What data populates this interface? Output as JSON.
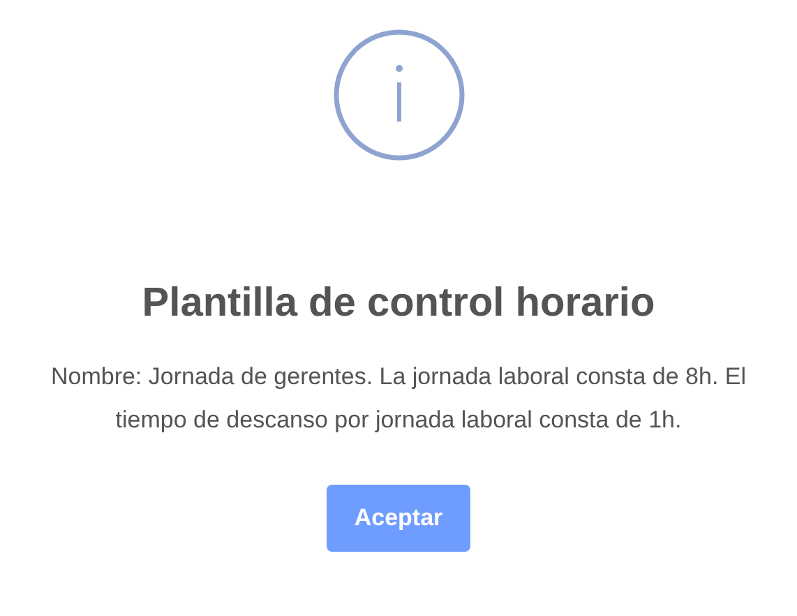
{
  "dialog": {
    "title": "Plantilla de control horario",
    "message": "Nombre: Jornada de gerentes. La jornada laboral consta de 8h. El tiempo de descanso por jornada laboral consta de 1h.",
    "buttons": [
      {
        "label": "Aceptar",
        "kind": "confirm"
      }
    ]
  }
}
